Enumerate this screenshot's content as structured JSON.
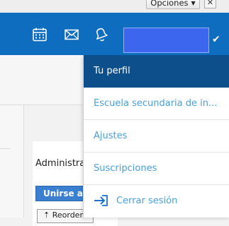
{
  "topbar": {
    "options_label": "Opciones",
    "options_caret": "▼",
    "close_symbol": "✕"
  },
  "header": {
    "icons": [
      "calendar-icon",
      "mail-icon",
      "notification-bell-icon"
    ],
    "user_check": "✔",
    "accent_color": "#0f6dbf"
  },
  "dropdown": {
    "items": [
      {
        "label": "Tu perfil",
        "active": true
      },
      {
        "label": "Escuela secundaria de in..."
      },
      {
        "label": "Ajustes"
      },
      {
        "label": "Suscripciones"
      },
      {
        "label": "Cerrar sesión",
        "icon": "logout-icon"
      }
    ],
    "active_bg": "#0d4f8b",
    "link_color": "#4a9fd8"
  },
  "main": {
    "panel_title": "Administra",
    "join_label": "Unirse a u",
    "reorder_label": "⇡ Reorden"
  }
}
